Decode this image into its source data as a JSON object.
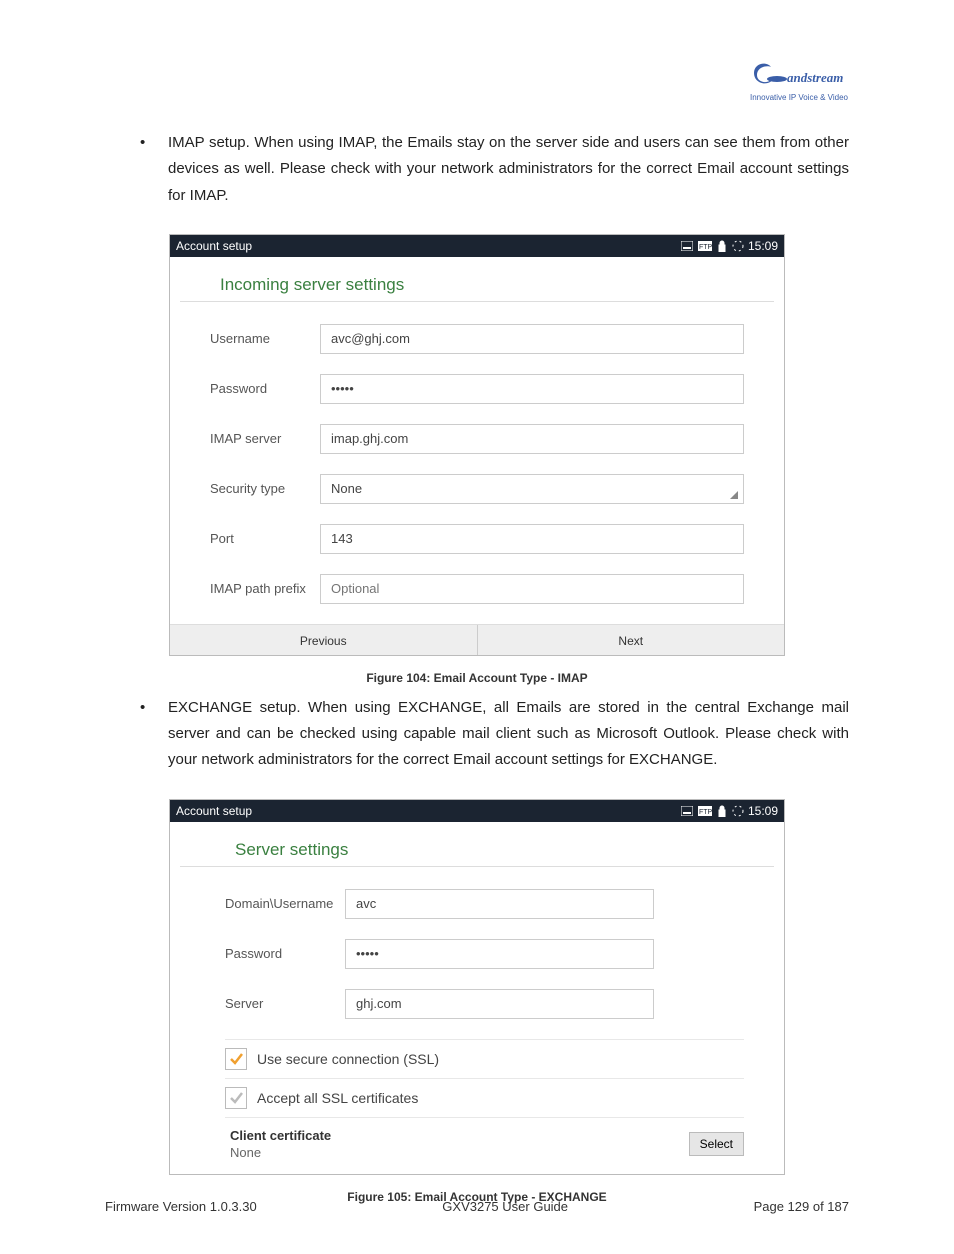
{
  "logo": {
    "tagline": "Innovative IP Voice & Video"
  },
  "sectionA": {
    "bullet": "IMAP setup. When using IMAP, the Emails stay on the server side and users can see them from other devices as well. Please check with your network administrators for the correct Email account settings for IMAP.",
    "caption": "Figure 104: Email Account Type - IMAP",
    "shot": {
      "title": "Account setup",
      "time": "15:09",
      "header": "Incoming server settings",
      "rows": {
        "usernameL": "Username",
        "usernameV": "avc@ghj.com",
        "passwordL": "Password",
        "passwordV": "•••••",
        "imapSrvL": "IMAP server",
        "imapSrvV": "imap.ghj.com",
        "secTypeL": "Security type",
        "secTypeV": "None",
        "portL": "Port",
        "portV": "143",
        "prefixL": "IMAP path prefix",
        "prefixPH": "Optional"
      },
      "prev": "Previous",
      "next": "Next"
    }
  },
  "sectionB": {
    "bullet": "EXCHANGE setup. When using EXCHANGE, all Emails are stored in the central Exchange mail server and can be checked using capable mail client such as Microsoft Outlook. Please check with your network administrators for the correct Email account settings for EXCHANGE.",
    "caption": "Figure 105: Email Account Type - EXCHANGE",
    "shot": {
      "title": "Account setup",
      "time": "15:09",
      "header": "Server settings",
      "rows": {
        "domUserL": "Domain\\Username",
        "domUserV": "avc",
        "passwordL": "Password",
        "passwordV": "•••••",
        "serverL": "Server",
        "serverV": "ghj.com"
      },
      "sslL": "Use secure connection (SSL)",
      "acceptL": "Accept all SSL certificates",
      "certHd": "Client certificate",
      "certVal": "None",
      "certBtn": "Select"
    }
  },
  "footer": {
    "left": "Firmware Version 1.0.3.30",
    "center": "GXV3275 User Guide",
    "right": "Page 129 of 187"
  }
}
